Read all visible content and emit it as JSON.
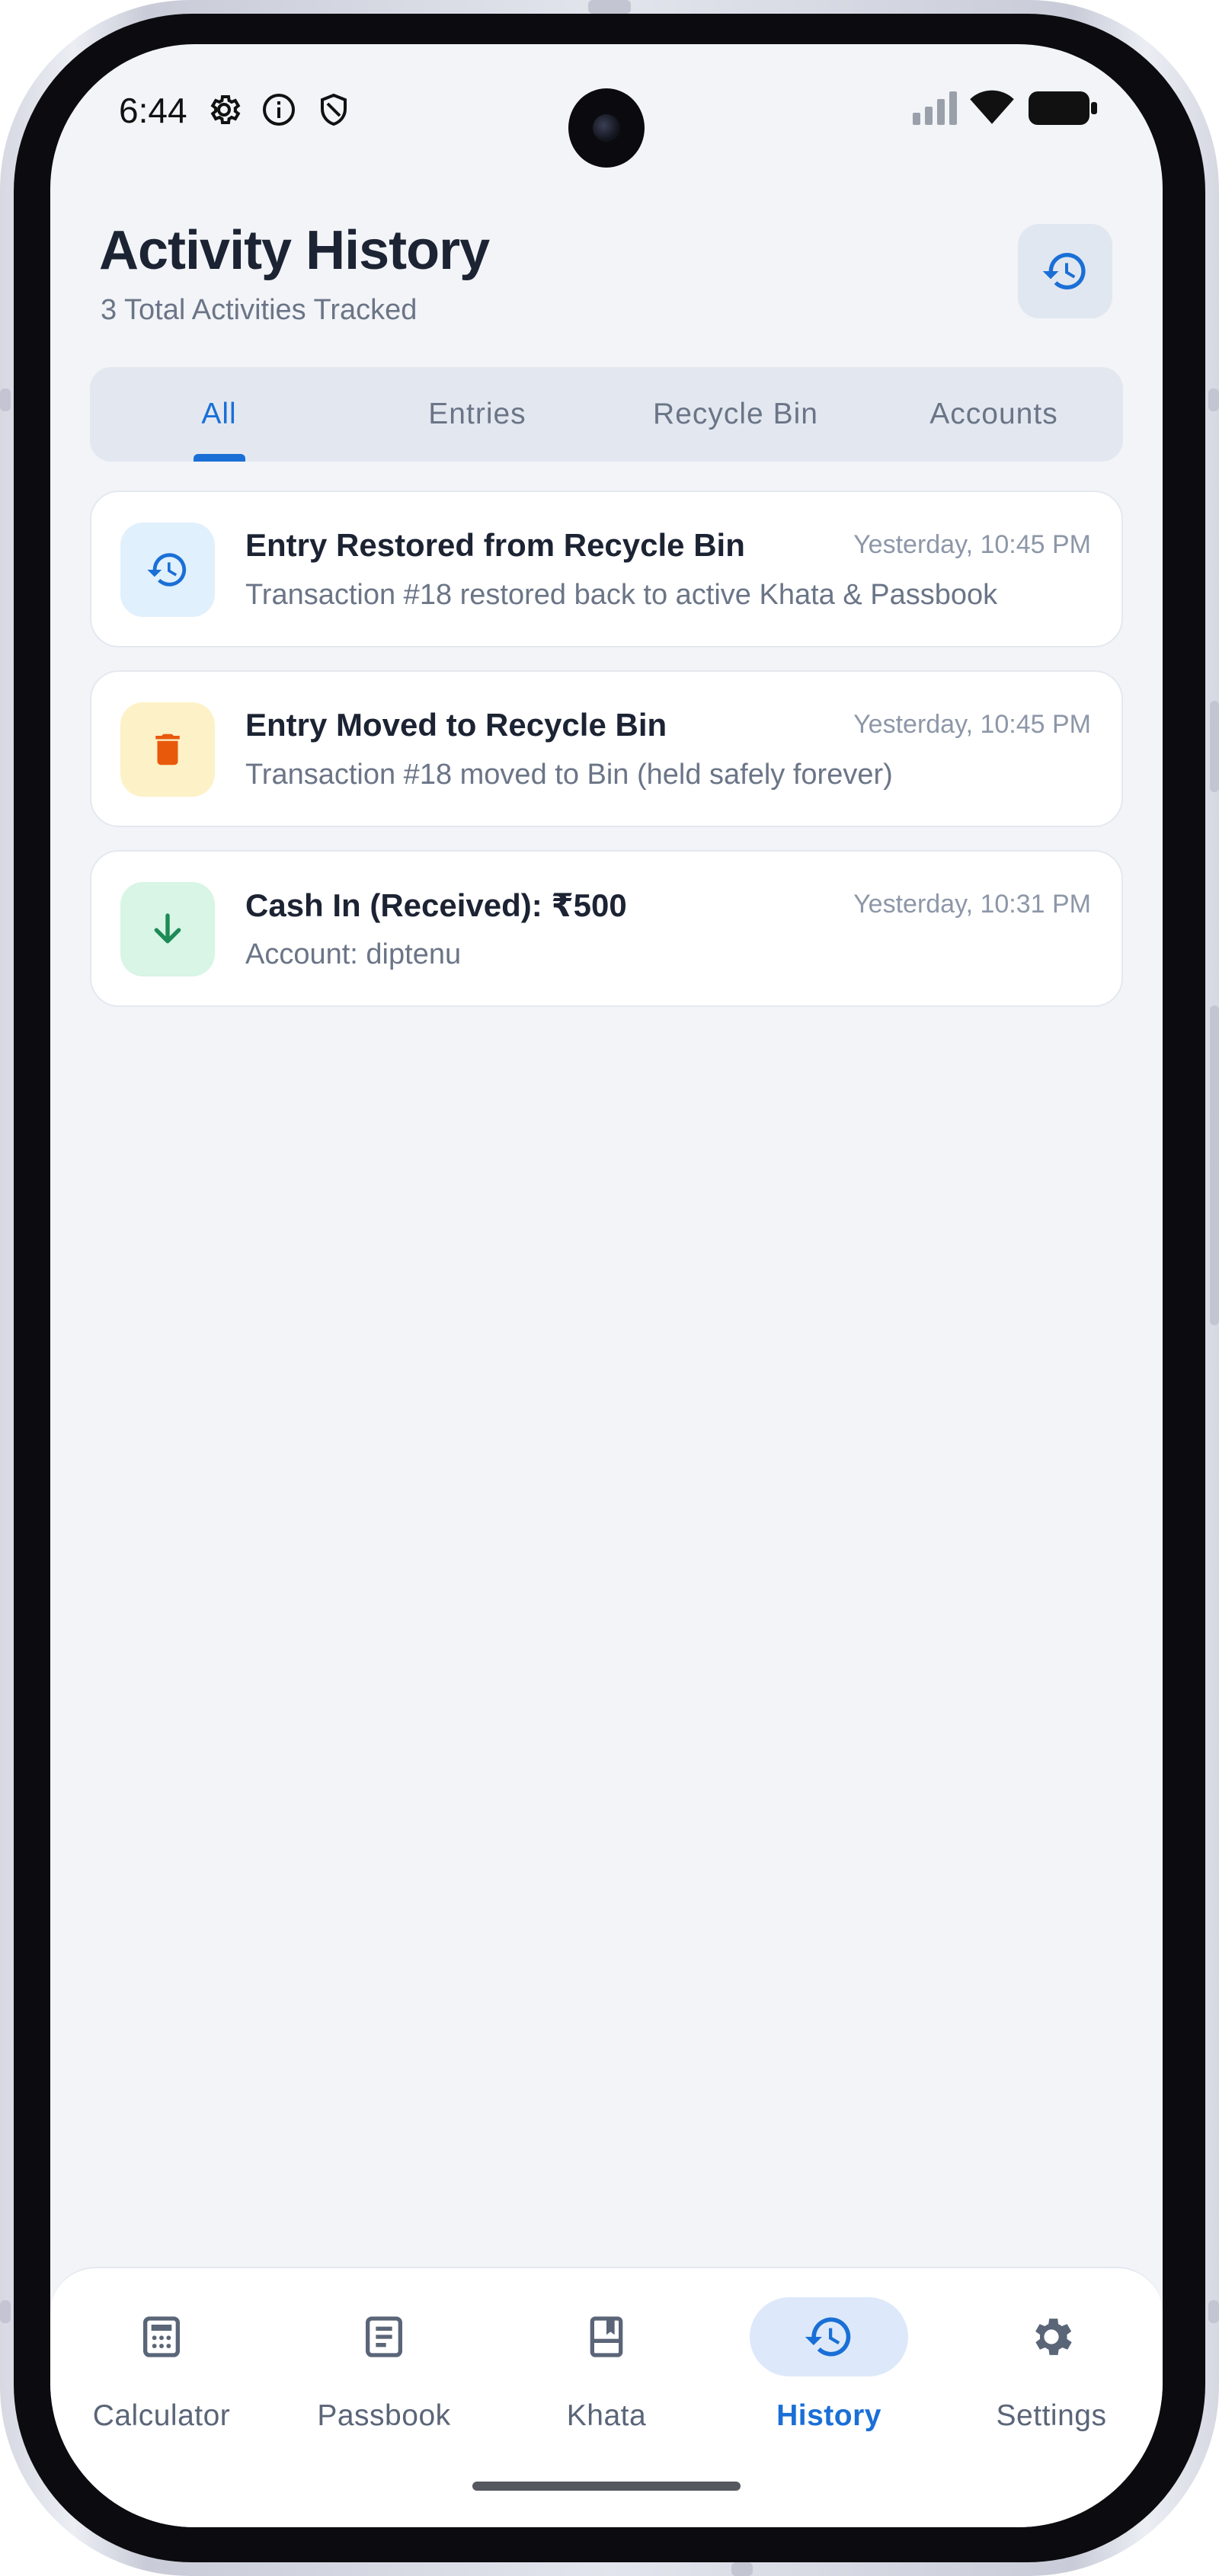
{
  "status_bar": {
    "time": "6:44",
    "icons": [
      "gear-icon",
      "info-icon",
      "shield-icon",
      "signal-icon",
      "wifi-icon",
      "battery-icon"
    ]
  },
  "header": {
    "title": "Activity History",
    "subtitle": "3 Total Activities Tracked",
    "action_icon": "history-icon"
  },
  "tabs": [
    {
      "label": "All",
      "active": true
    },
    {
      "label": "Entries",
      "active": false
    },
    {
      "label": "Recycle Bin",
      "active": false
    },
    {
      "label": "Accounts",
      "active": false
    }
  ],
  "activities": [
    {
      "title": "Entry Restored from Recycle Bin",
      "description": "Transaction #18 restored back to active Khata & Passbook",
      "time": "Yesterday, 10:45 PM",
      "icon": "restore-history-icon",
      "icon_color": "#1a6fd6",
      "icon_bg": "#e1f0fd"
    },
    {
      "title": "Entry Moved to Recycle Bin",
      "description": "Transaction #18 moved to Bin (held safely forever)",
      "time": "Yesterday, 10:45 PM",
      "icon": "trash-icon",
      "icon_color": "#e8590c",
      "icon_bg": "#fdf1c8"
    },
    {
      "title": "Cash In (Received): ₹500",
      "description": "Account: diptenu",
      "time": "Yesterday, 10:31 PM",
      "icon": "arrow-down-icon",
      "icon_color": "#1e8a55",
      "icon_bg": "#d8f5e6"
    }
  ],
  "bottom_nav": [
    {
      "label": "Calculator",
      "icon": "calculator-icon",
      "active": false
    },
    {
      "label": "Passbook",
      "icon": "passbook-icon",
      "active": false
    },
    {
      "label": "Khata",
      "icon": "khata-book-icon",
      "active": false
    },
    {
      "label": "History",
      "icon": "history-icon",
      "active": true
    },
    {
      "label": "Settings",
      "icon": "settings-icon",
      "active": false
    }
  ],
  "colors": {
    "accent": "#1a6fd6",
    "background": "#f2f4f8",
    "title_text": "#1c2333",
    "muted_text": "#6b7587"
  }
}
